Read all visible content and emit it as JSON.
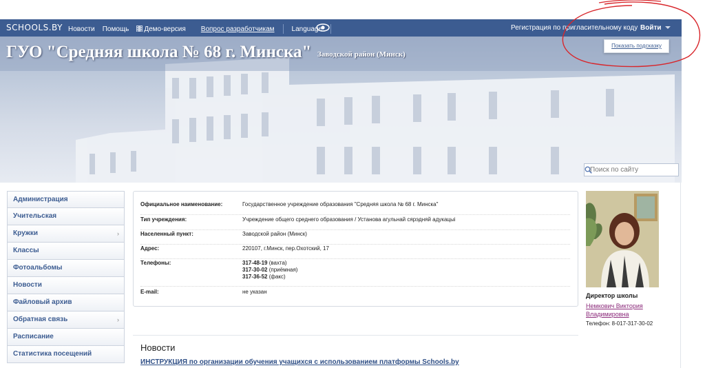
{
  "topbar": {
    "logo": "SCHOOLS.BY",
    "nav": [
      "Новости",
      "Помощь",
      "Демо-версия",
      "Вопрос разработчикам"
    ],
    "language": "Language",
    "register": "Регистрация по пригласительному коду",
    "login": "Войти"
  },
  "tooltip": "Показать подсказку",
  "header": {
    "title": "ГУО \"Средняя школа № 68 г. Минска\"",
    "district": "Заводской район (Минск)",
    "search_placeholder": "Поиск по сайту"
  },
  "sidebar": {
    "items": [
      {
        "label": "Администрация"
      },
      {
        "label": "Учительская"
      },
      {
        "label": "Кружки",
        "arrow": "›"
      },
      {
        "label": "Классы"
      },
      {
        "label": "Фотоальбомы"
      },
      {
        "label": "Новости"
      },
      {
        "label": "Файловый архив"
      },
      {
        "label": "Обратная связь",
        "arrow": "›"
      },
      {
        "label": "Расписание"
      },
      {
        "label": "Статистика посещений"
      }
    ]
  },
  "info": {
    "official_name_label": "Официальное наименование:",
    "official_name": "Государственное учреждение образования \"Средняя школа № 68 г. Минска\"",
    "type_label": "Тип учреждения:",
    "type": "Учреждение общего среднего образования / Установа агульнай сярэдняй адукацыі",
    "locality_label": "Населенный пункт:",
    "locality": "Заводской район (Минск)",
    "address_label": "Адрес:",
    "address": "220107, г.Минск, пер.Охотский, 17",
    "phones_label": "Телефоны:",
    "phones": [
      {
        "number": "317-48-19",
        "note": "(вахта)"
      },
      {
        "number": "317-30-02",
        "note": "(приёмная)"
      },
      {
        "number": "317-36-52",
        "note": "(факс)"
      }
    ],
    "email_label": "E-mail:",
    "email": "не указан"
  },
  "director": {
    "role": "Директор школы",
    "name_line1": "Немкович Виктория",
    "name_line2": "Владимировна",
    "phone": "Телефон: 8-017-317-30-02"
  },
  "news": {
    "heading": "Новости",
    "link": "ИНСТРУКЦИЯ по организации обучения учащихся с использованием платформы Schools.by"
  },
  "colors": {
    "topbar": "#3c5c91",
    "link": "#2f4f86",
    "director_link": "#8b2a7a",
    "annotation": "#d8262b"
  },
  "icons": {
    "demo": "film-icon",
    "eye": "eye-icon",
    "search": "search-icon",
    "submenu": "chevron-right-icon",
    "login": "caret-down-icon"
  }
}
